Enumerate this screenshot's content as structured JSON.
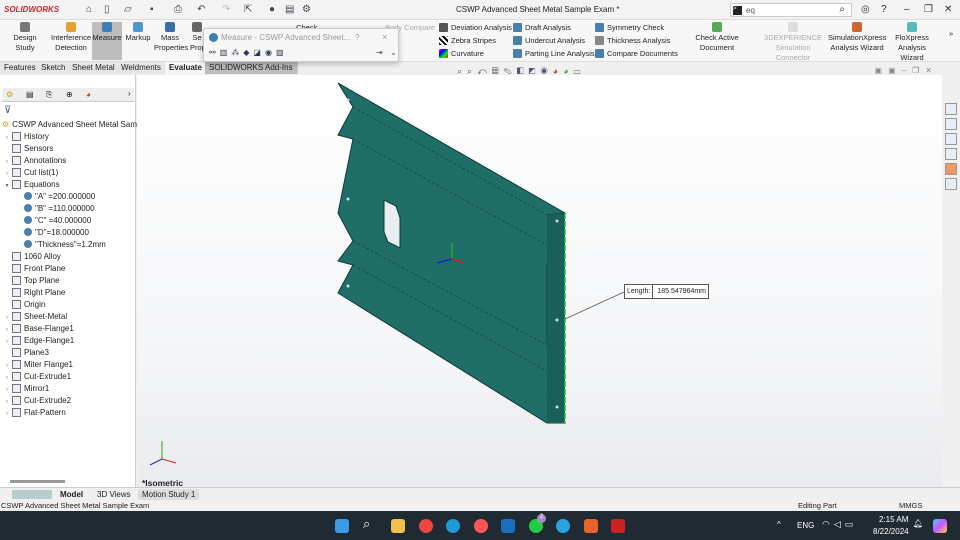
{
  "app": {
    "logo": "SOLIDWORKS",
    "title": "CSWP Advanced Sheet Metal Sample Exam *",
    "search_value": "eq"
  },
  "ribbon": {
    "big": [
      "Design Study",
      "Interference Detection",
      "Measure",
      "Markup",
      "Mass Properties",
      "Se Prop"
    ],
    "check": "Check",
    "body_compare": "Body Compare",
    "col1": [
      "Deviation Analysis",
      "Zebra Stripes",
      "Curvature"
    ],
    "col2": [
      "Draft Analysis",
      "Undercut Analysis",
      "Parting Line Analysis"
    ],
    "col3": [
      "Symmetry Check",
      "Thickness Analysis",
      "Compare Documents"
    ],
    "check_active": "Check Active Document",
    "sim_connector": "3DEXPERIENCE Simulation Connector",
    "simxpress": "SimulationXpress Analysis Wizard",
    "floxpress": "FloXpress Analysis Wizard"
  },
  "tabs": [
    "Features",
    "Sketch",
    "Sheet Metal",
    "Weldments",
    "Evaluate",
    "SOLIDWORKS Add-Ins"
  ],
  "measure_dialog": {
    "title": "Measure - CSWP Advanced Sheet...",
    "help": "?",
    "close": "×"
  },
  "tree": {
    "root": "CSWP Advanced Sheet Metal Sample",
    "items": [
      {
        "label": "History",
        "exp": true
      },
      {
        "label": "Sensors",
        "exp": false
      },
      {
        "label": "Annotations",
        "exp": true
      },
      {
        "label": "Cut list(1)",
        "exp": true
      },
      {
        "label": "Equations",
        "exp": "open"
      }
    ],
    "equations": [
      "\"A\" =200.000000",
      "\"B\" =110.000000",
      "\"C\" =40.000000",
      "\"D\"=18.000000",
      "\"Thickness\"=1.2mm"
    ],
    "features": [
      {
        "label": "1060 Alloy",
        "exp": false
      },
      {
        "label": "Front Plane",
        "exp": false
      },
      {
        "label": "Top Plane",
        "exp": false
      },
      {
        "label": "Right Plane",
        "exp": false
      },
      {
        "label": "Origin",
        "exp": false
      },
      {
        "label": "Sheet-Metal",
        "exp": true
      },
      {
        "label": "Base-Flange1",
        "exp": true
      },
      {
        "label": "Edge-Flange1",
        "exp": true
      },
      {
        "label": "Plane3",
        "exp": false
      },
      {
        "label": "Miter Flange1",
        "exp": true
      },
      {
        "label": "Cut-Extrude1",
        "exp": true
      },
      {
        "label": "Mirror1",
        "exp": true
      },
      {
        "label": "Cut-Extrude2",
        "exp": true
      },
      {
        "label": "Flat-Pattern",
        "exp": true
      }
    ]
  },
  "viewport": {
    "view_name": "*Isometric",
    "measure_label": "Length:",
    "measure_value": "185.547964mm",
    "part_color": "#1f6e68"
  },
  "bottom_tabs": [
    "Model",
    "3D Views",
    "Motion Study 1"
  ],
  "status": {
    "doc": "CSWP Advanced Sheet Metal Sample Exam",
    "mode": "Editing Part",
    "units": "MMGS"
  },
  "taskbar": {
    "lang": "ENG",
    "time": "2:15 AM",
    "date": "8/22/2024",
    "badge": "2"
  }
}
